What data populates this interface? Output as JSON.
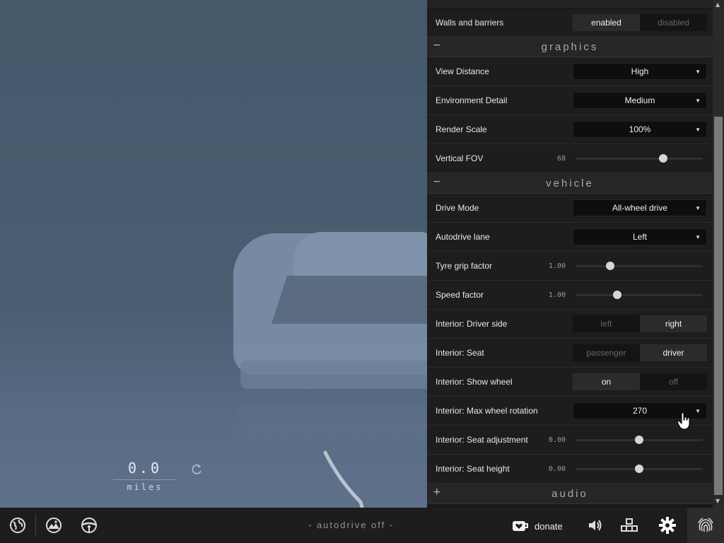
{
  "panel": {
    "walls": {
      "label": "Walls and barriers",
      "options": [
        "enabled",
        "disabled"
      ],
      "selected": 0
    },
    "graphics": {
      "title": "graphics",
      "sign": "−",
      "view_distance": {
        "label": "View Distance",
        "value": "High"
      },
      "env_detail": {
        "label": "Environment Detail",
        "value": "Medium"
      },
      "render_scale": {
        "label": "Render Scale",
        "value": "100%"
      },
      "vertical_fov": {
        "label": "Vertical FOV",
        "value": "68",
        "level": 0.69
      }
    },
    "vehicle": {
      "title": "vehicle",
      "sign": "−",
      "drive_mode": {
        "label": "Drive Mode",
        "value": "All-wheel drive"
      },
      "autodrive_lane": {
        "label": "Autodrive lane",
        "value": "Left"
      },
      "tyre_grip": {
        "label": "Tyre grip factor",
        "value": "1.00",
        "level": 0.27
      },
      "speed_factor": {
        "label": "Speed factor",
        "value": "1.00",
        "level": 0.33
      },
      "driver_side": {
        "label": "Interior: Driver side",
        "options": [
          "left",
          "right"
        ],
        "selected": 1
      },
      "seat": {
        "label": "Interior: Seat",
        "options": [
          "passenger",
          "driver"
        ],
        "selected": 1
      },
      "show_wheel": {
        "label": "Interior: Show wheel",
        "options": [
          "on",
          "off"
        ],
        "selected": 0
      },
      "max_wheel_rotation": {
        "label": "Interior: Max wheel rotation",
        "value": "270"
      },
      "seat_adjustment": {
        "label": "Interior: Seat adjustment",
        "value": "0.00",
        "level": 0.5
      },
      "seat_height": {
        "label": "Interior: Seat height",
        "value": "0.00",
        "level": 0.5
      }
    },
    "audio": {
      "title": "audio",
      "sign": "+"
    }
  },
  "odometer": {
    "value": "0.0",
    "unit": "miles"
  },
  "bottombar": {
    "autodrive": "- autodrive off -",
    "donate": "donate"
  },
  "icons": [
    "globe-icon",
    "mountains-icon",
    "steering-wheel-icon",
    "refresh-icon",
    "heart-icon",
    "speaker-icon",
    "blocks-icon",
    "gear-icon",
    "fingerprint-icon"
  ],
  "colors": {
    "panel_bg": "#181818",
    "row_bg": "#1d1d1d",
    "accent_text": "#f0f0f0",
    "scene_fog": "#45596b"
  }
}
